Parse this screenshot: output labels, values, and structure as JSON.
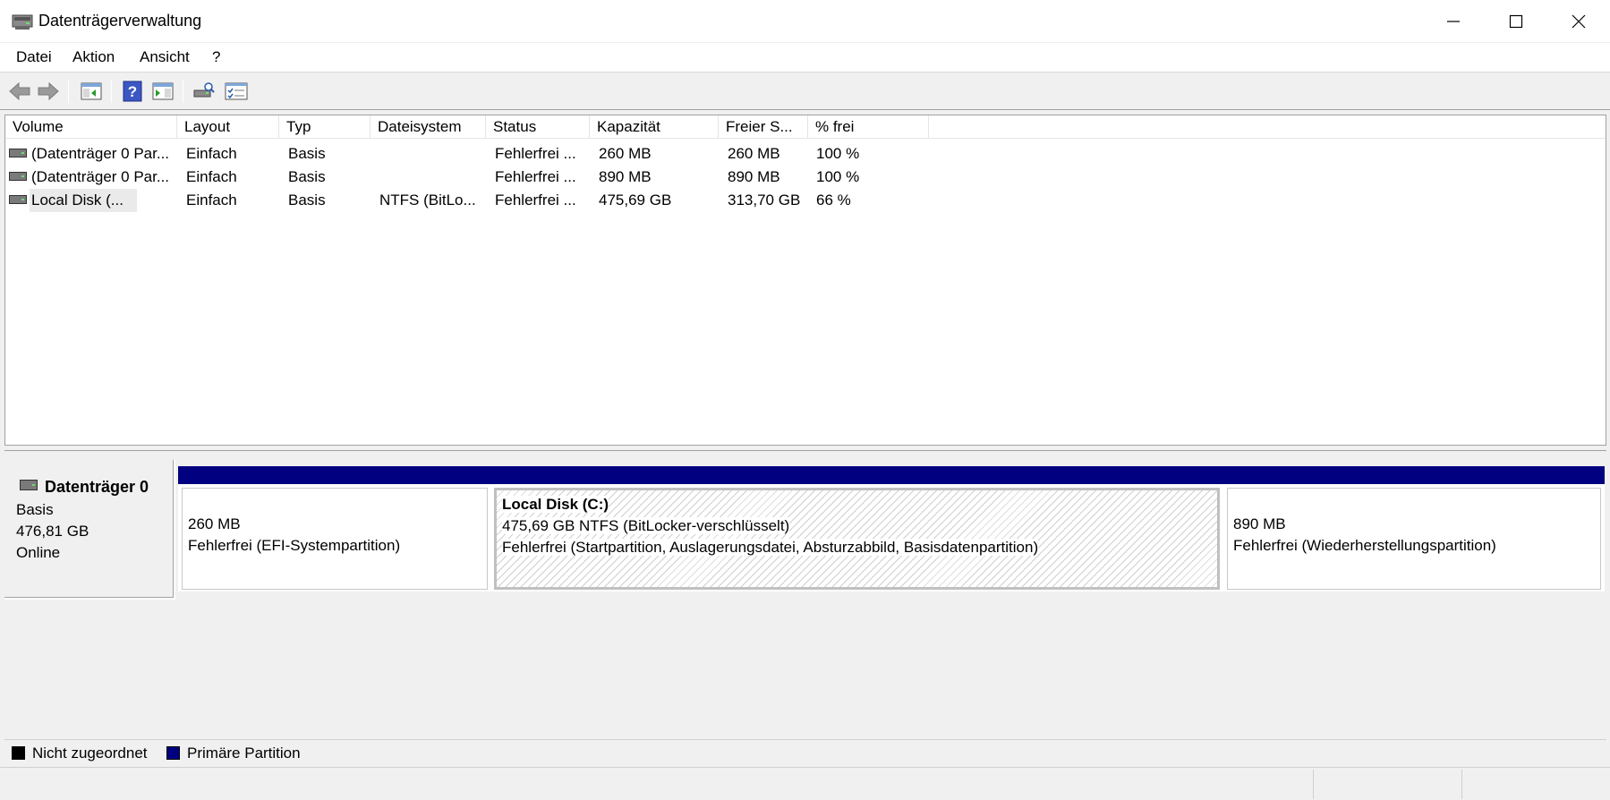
{
  "window": {
    "title": "Datenträgerverwaltung"
  },
  "menu": {
    "items": [
      {
        "label": "Datei"
      },
      {
        "label": "Aktion"
      },
      {
        "label": "Ansicht"
      },
      {
        "label": "?"
      }
    ]
  },
  "volumes": {
    "columns": [
      "Volume",
      "Layout",
      "Typ",
      "Dateisystem",
      "Status",
      "Kapazität",
      "Freier S...",
      "% frei"
    ],
    "rows": [
      {
        "volume": "(Datenträger 0 Par...",
        "layout": "Einfach",
        "typ": "Basis",
        "dateisystem": "",
        "status": "Fehlerfrei ...",
        "kapazitaet": "260 MB",
        "frei": "260 MB",
        "prozent": "100 %"
      },
      {
        "volume": "(Datenträger 0 Par...",
        "layout": "Einfach",
        "typ": "Basis",
        "dateisystem": "",
        "status": "Fehlerfrei ...",
        "kapazitaet": "890 MB",
        "frei": "890 MB",
        "prozent": "100 %"
      },
      {
        "volume": "Local Disk (...",
        "layout": "Einfach",
        "typ": "Basis",
        "dateisystem": "NTFS (BitLo...",
        "status": "Fehlerfrei ...",
        "kapazitaet": "475,69 GB",
        "frei": "313,70 GB",
        "prozent": "66 %"
      }
    ]
  },
  "disk": {
    "name": "Datenträger 0",
    "type": "Basis",
    "size": "476,81 GB",
    "state": "Online",
    "partitions": [
      {
        "title": "",
        "size": "260 MB",
        "status": "Fehlerfrei (EFI-Systempartition)"
      },
      {
        "title": "Local Disk  (C:)",
        "size": "475,69 GB NTFS (BitLocker-verschlüsselt)",
        "status": "Fehlerfrei (Startpartition, Auslagerungsdatei, Absturzabbild, Basisdatenpartition)"
      },
      {
        "title": "",
        "size": "890 MB",
        "status": "Fehlerfrei (Wiederherstellungspartition)"
      }
    ]
  },
  "legend": {
    "unallocated": "Nicht zugeordnet",
    "primary": "Primäre Partition",
    "unallocated_color": "#000000",
    "primary_color": "#000080"
  },
  "icons": {
    "app": "disk-management-icon",
    "back": "back-arrow-icon",
    "forward": "forward-arrow-icon",
    "console_tree": "show-hide-console-tree-icon",
    "help": "help-icon",
    "action_pane": "show-hide-action-pane-icon",
    "rescan": "rescan-disks-icon",
    "properties": "properties-icon"
  }
}
